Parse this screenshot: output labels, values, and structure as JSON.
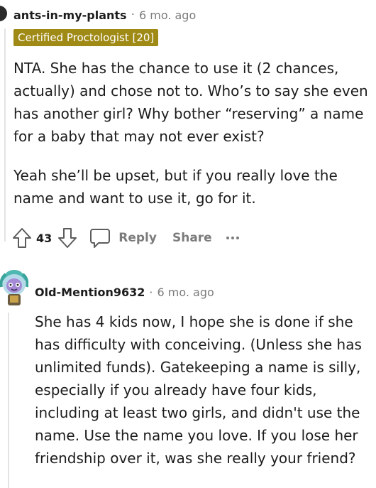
{
  "comment": {
    "username": "ants-in-my-plants",
    "separator": "·",
    "time": "6 mo. ago",
    "flair": "Certified Proctologist [20]",
    "paragraphs": [
      "NTA. She has the chance to use it (2 chances, actually) and chose not to. Who’s to say she even has another girl? Why bother “reserving” a name for a baby that may not ever exist?",
      "Yeah she’ll be upset, but if you really love the name and want to use it, go for it."
    ],
    "votes": "43",
    "reply_label": "Reply",
    "share_label": "Share"
  },
  "reply": {
    "username": "Old-Mention9632",
    "separator": "·",
    "time": "6 mo. ago",
    "paragraph": "She has 4 kids now, I hope she is done if she has difficulty with conceiving. (Unless she has unlimited funds). Gatekeeping a name is silly, especially if you already have four kids, including at least two girls, and didn't use the name. Use the name you love. If you lose her friendship over it, was she really your friend?"
  },
  "icons": {
    "upvote": "upvote-arrow-icon",
    "downvote": "downvote-arrow-icon",
    "reply": "comment-bubble-icon",
    "more": "ellipsis-icon"
  },
  "colors": {
    "flair_bg": "#a08a16",
    "meta_gray": "#7c7c7c",
    "text": "#1c1c1c"
  }
}
